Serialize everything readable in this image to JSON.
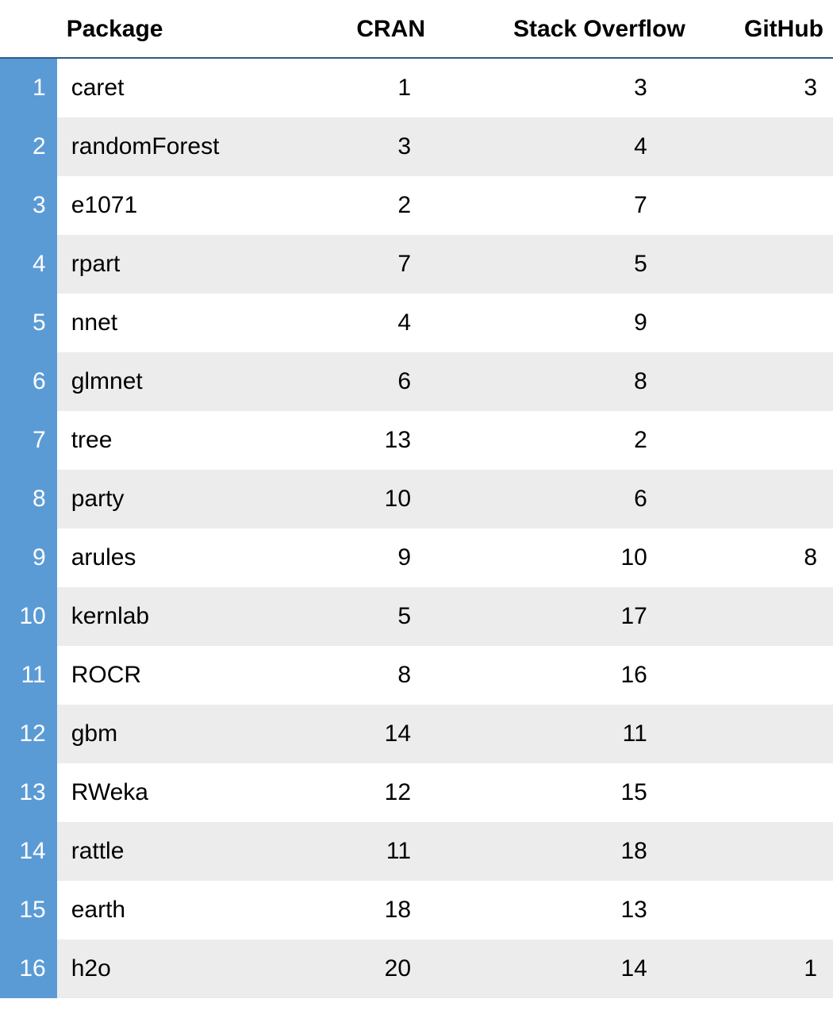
{
  "table": {
    "headers": {
      "package": "Package",
      "cran": "CRAN",
      "stack_overflow": "Stack Overflow",
      "github": "GitHub"
    },
    "rows": [
      {
        "index": "1",
        "package": "caret",
        "cran": "1",
        "stack_overflow": "3",
        "github": "3"
      },
      {
        "index": "2",
        "package": "randomForest",
        "cran": "3",
        "stack_overflow": "4",
        "github": ""
      },
      {
        "index": "3",
        "package": "e1071",
        "cran": "2",
        "stack_overflow": "7",
        "github": ""
      },
      {
        "index": "4",
        "package": "rpart",
        "cran": "7",
        "stack_overflow": "5",
        "github": ""
      },
      {
        "index": "5",
        "package": "nnet",
        "cran": "4",
        "stack_overflow": "9",
        "github": ""
      },
      {
        "index": "6",
        "package": "glmnet",
        "cran": "6",
        "stack_overflow": "8",
        "github": ""
      },
      {
        "index": "7",
        "package": "tree",
        "cran": "13",
        "stack_overflow": "2",
        "github": ""
      },
      {
        "index": "8",
        "package": "party",
        "cran": "10",
        "stack_overflow": "6",
        "github": ""
      },
      {
        "index": "9",
        "package": "arules",
        "cran": "9",
        "stack_overflow": "10",
        "github": "8"
      },
      {
        "index": "10",
        "package": "kernlab",
        "cran": "5",
        "stack_overflow": "17",
        "github": ""
      },
      {
        "index": "11",
        "package": "ROCR",
        "cran": "8",
        "stack_overflow": "16",
        "github": ""
      },
      {
        "index": "12",
        "package": "gbm",
        "cran": "14",
        "stack_overflow": "11",
        "github": ""
      },
      {
        "index": "13",
        "package": "RWeka",
        "cran": "12",
        "stack_overflow": "15",
        "github": ""
      },
      {
        "index": "14",
        "package": "rattle",
        "cran": "11",
        "stack_overflow": "18",
        "github": ""
      },
      {
        "index": "15",
        "package": "earth",
        "cran": "18",
        "stack_overflow": "13",
        "github": ""
      },
      {
        "index": "16",
        "package": "h2o",
        "cran": "20",
        "stack_overflow": "14",
        "github": "1"
      }
    ]
  },
  "chart_data": {
    "type": "table",
    "title": "",
    "columns": [
      "Package",
      "CRAN",
      "Stack Overflow",
      "GitHub"
    ],
    "rows": [
      [
        "caret",
        1,
        3,
        3
      ],
      [
        "randomForest",
        3,
        4,
        null
      ],
      [
        "e1071",
        2,
        7,
        null
      ],
      [
        "rpart",
        7,
        5,
        null
      ],
      [
        "nnet",
        4,
        9,
        null
      ],
      [
        "glmnet",
        6,
        8,
        null
      ],
      [
        "tree",
        13,
        2,
        null
      ],
      [
        "party",
        10,
        6,
        null
      ],
      [
        "arules",
        9,
        10,
        8
      ],
      [
        "kernlab",
        5,
        17,
        null
      ],
      [
        "ROCR",
        8,
        16,
        null
      ],
      [
        "gbm",
        14,
        11,
        null
      ],
      [
        "RWeka",
        12,
        15,
        null
      ],
      [
        "rattle",
        11,
        18,
        null
      ],
      [
        "earth",
        18,
        13,
        null
      ],
      [
        "h2o",
        20,
        14,
        1
      ]
    ]
  }
}
